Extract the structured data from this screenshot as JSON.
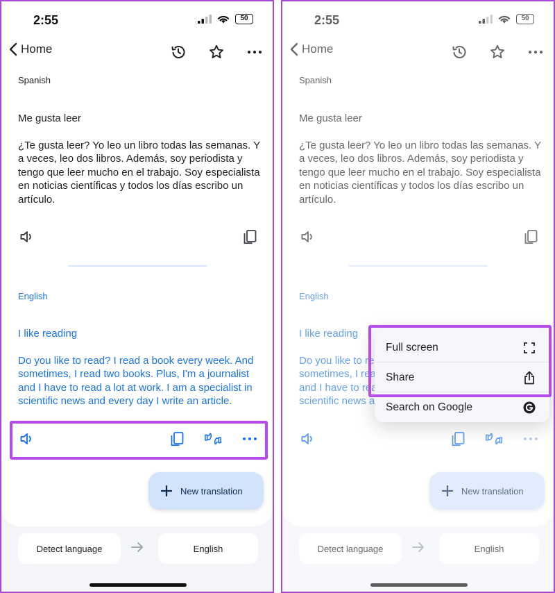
{
  "status": {
    "time": "2:55",
    "battery": "50"
  },
  "header": {
    "back_label": "Home"
  },
  "source": {
    "language": "Spanish",
    "title": "Me gusta leer",
    "body": "¿Te gusta leer? Yo leo un libro todas las semanas. Y a veces, leo dos libros. Además, soy periodista y tengo que leer mucho en el trabajo. Soy especialista en noticias científicas y todos los días escribo un artículo."
  },
  "target": {
    "language": "English",
    "title": "I like reading",
    "body": "Do you like to read? I read a book every week. And sometimes, I read two books. Plus, I'm a journalist and I have to read a lot at work. I am a specialist in scientific news and every day I write an article."
  },
  "fab": {
    "label": "New translation"
  },
  "bottom": {
    "source_lang": "Detect language",
    "target_lang": "English"
  },
  "menu": {
    "items": [
      {
        "label": "Full screen",
        "icon": "fullscreen-icon"
      },
      {
        "label": "Share",
        "icon": "share-icon"
      },
      {
        "label": "Search on Google",
        "icon": "google-icon"
      }
    ]
  },
  "colors": {
    "accent": "#1a73e8",
    "highlight": "#b44ce8",
    "fab_bg": "#d4e3fc"
  }
}
